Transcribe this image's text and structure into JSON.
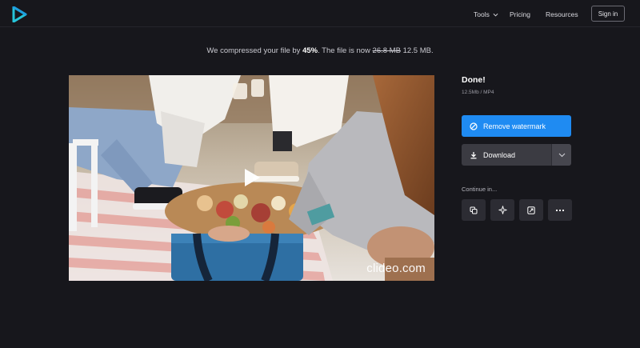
{
  "header": {
    "logo_icon": "clideo-play-logo-icon",
    "nav": {
      "tools_label": "Tools",
      "pricing_label": "Pricing",
      "resources_label": "Resources",
      "signin_label": "Sign in"
    }
  },
  "message": {
    "prefix": "We compressed your file by ",
    "percent": "45%",
    "middle": ". The file is now ",
    "old_size": "26.8 MB",
    "new_size": " 12.5 MB."
  },
  "video": {
    "watermark": "clideo.com",
    "play_icon": "play-icon"
  },
  "panel": {
    "title": "Done!",
    "meta": "12.5Mb  /  MP4",
    "remove_watermark_label": "Remove watermark",
    "download_label": "Download",
    "continue_label": "Continue in...",
    "tools": [
      {
        "icon": "copy-icon"
      },
      {
        "icon": "sparkle-icon"
      },
      {
        "icon": "resize-icon"
      },
      {
        "icon": "more-icon"
      }
    ]
  },
  "colors": {
    "background": "#17171c",
    "accent": "#1f8bf2",
    "logo": "#26c4d9"
  }
}
